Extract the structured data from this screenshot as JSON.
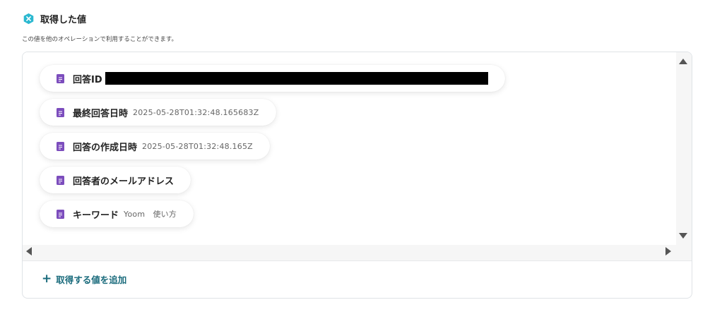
{
  "header": {
    "title": "取得した値",
    "subtitle": "この値を他のオペレーションで利用することができます。",
    "icon": "yoom-logo-icon",
    "accent": "#2bb8d0"
  },
  "values": [
    {
      "label": "回答ID",
      "value": "",
      "redacted": true
    },
    {
      "label": "最終回答日時",
      "value": "2025-05-28T01:32:48.165683Z"
    },
    {
      "label": "回答の作成日時",
      "value": "2025-05-28T01:32:48.165Z"
    },
    {
      "label": "回答者のメールアドレス",
      "value": ""
    },
    {
      "label": "キーワード",
      "value": "Yoom　使い方"
    }
  ],
  "value_icon": "document-icon",
  "value_icon_color": "#7c4dbd",
  "add_button": {
    "label": "取得する値を追加",
    "icon": "plus-icon",
    "color": "#1a6b7c"
  }
}
